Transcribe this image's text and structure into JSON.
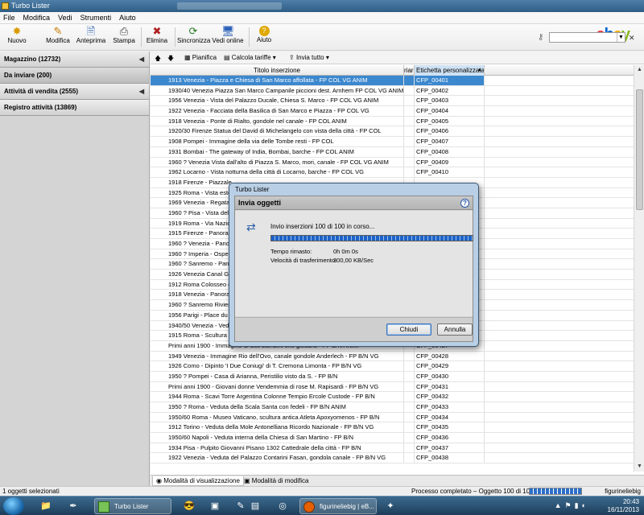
{
  "window": {
    "title": "Turbo Lister"
  },
  "menu": [
    "File",
    "Modifica",
    "Vedi",
    "Strumenti",
    "Aiuto"
  ],
  "toolbar": {
    "buttons": [
      "Nuovo",
      "Modifica",
      "Anteprima",
      "Stampa",
      "Elimina",
      "Sincronizza",
      "Vedi online",
      "Aiuto"
    ]
  },
  "brand": {
    "e": "e",
    "b": "b",
    "a": "a",
    "y": "y"
  },
  "sidebar": {
    "items": [
      "Magazzino (12732)",
      "Da inviare (200)",
      "Attività di vendita (2555)",
      "Registro attività (13869)"
    ]
  },
  "content_toolbar": {
    "pianifica": "Pianifica",
    "calcola": "Calcola tariffe",
    "invia": "Invia tutto"
  },
  "table": {
    "headers": {
      "title": "Titolo inserzione",
      "r": "riar",
      "label": "Etichetta personalizzata"
    },
    "sort_indicator": "▲",
    "rows": [
      {
        "title": "1913 Venezia - Piazza e Chiesa di San Marco affollata - FP COL VG ANIM",
        "label": "CFP_00401"
      },
      {
        "title": "1930/40 Venezia Piazza San Marco Campanile piccioni dest. Arnhem FP COL VG ANIM",
        "label": "CFP_00402"
      },
      {
        "title": "1956 Venezia - Vista del Palazzo Ducale, Chiesa S. Marco - FP COL VG ANIM",
        "label": "CFP_00403"
      },
      {
        "title": "1922 Venezia - Facciata della Basilica di San Marco e Piazza - FP COL VG",
        "label": "CFP_00404"
      },
      {
        "title": "1918 Venezia - Ponte di Rialto, gondole nel canale - FP COL ANIM",
        "label": "CFP_00405"
      },
      {
        "title": "1920/30 Firenze Statua del David di Michelangelo con vista della città - FP COL",
        "label": "CFP_00406"
      },
      {
        "title": "1908 Pompei - Immagine della via delle Tombe resti - FP COL",
        "label": "CFP_00407"
      },
      {
        "title": "1931 Bombai - The gateway of India, Bombai, barche - FP COL ANIM",
        "label": "CFP_00408"
      },
      {
        "title": "1960 ? Venezia Vista dall'alto di Piazza S. Marco, mori, canale - FP COL VG ANIM",
        "label": "CFP_00409"
      },
      {
        "title": "1962 Locarno - Vista notturna della città di Locarno, barche - FP COL VG",
        "label": "CFP_00410"
      },
      {
        "title": "1918 Firenze - Piazzale",
        "label": ""
      },
      {
        "title": "1925 Roma - Vista este",
        "label": ""
      },
      {
        "title": "1969 Venezia - Regata",
        "label": ""
      },
      {
        "title": "1960 ? Pisa - Vista del D",
        "label": ""
      },
      {
        "title": "1919 Roma - Via Nazio",
        "label": ""
      },
      {
        "title": "1915 Firenze - Panoran",
        "label": ""
      },
      {
        "title": "1960 ? Venezia - Panor",
        "label": ""
      },
      {
        "title": "1960 ? Imperia - Osped",
        "label": ""
      },
      {
        "title": "1960 ? Sanremo - Panor",
        "label": ""
      },
      {
        "title": "1926 Venezia Canal Gra",
        "label": ""
      },
      {
        "title": "1912 Roma Colosseo di",
        "label": ""
      },
      {
        "title": "1918 Venezia - Panoran",
        "label": ""
      },
      {
        "title": "1960 ? Sanremo Riviera",
        "label": ""
      },
      {
        "title": "1956 Parigi - Place du C",
        "label": ""
      },
      {
        "title": "1940/50 Venezia - Veduta",
        "label": ""
      },
      {
        "title": "1915 Roma - Scultura",
        "label": ""
      },
      {
        "title": "Primi anni 1900 - Immagine di due bambini che giocano - FP B/N ANIM",
        "label": "CFP_00427"
      },
      {
        "title": "1949 Venezia - Immagine Rio dell'Ovo, canale gondole Anderlech - FP B/N VG",
        "label": "CFP_00428"
      },
      {
        "title": "1926 Como - Dipinto 'I Due Coniugi' di T. Cremona Limonta - FP B/N VG",
        "label": "CFP_00429"
      },
      {
        "title": "1950 ? Pompei - Casa di Arianna, Peristilio visto da S. - FP B/N",
        "label": "CFP_00430"
      },
      {
        "title": "Primi anni 1900 - Giovani donne Vendemmia di rose M. Rapisardi - FP B/N VG",
        "label": "CFP_00431"
      },
      {
        "title": "1944 Roma - Scavi Torre Argentina Colonne Tempio Ercole Custode - FP B/N",
        "label": "CFP_00432"
      },
      {
        "title": "1950 ? Roma - Veduta della Scala Santa con fedeli - FP B/N ANIM",
        "label": "CFP_00433"
      },
      {
        "title": "1950/60 Roma - Museo Vaticano, scultura antica Atleta Apoxyomenos - FP B/N",
        "label": "CFP_00434"
      },
      {
        "title": "1912 Torino - Veduta della Mole Antonelliana Ricordo Nazionale - FP B/N VG",
        "label": "CFP_00435"
      },
      {
        "title": "1950/60 Napoli - Veduta interna della Chiesa di San Martino - FP B/N",
        "label": "CFP_00436"
      },
      {
        "title": "1934 Pisa - Pulpito Giovanni Pisano 1302 Cattedrale della città - FP B/N",
        "label": "CFP_00437"
      },
      {
        "title": "1922 Venezia - Veduta del Palazzo Contarini Fasan, gondola canale - FP B/N VG",
        "label": "CFP_00438"
      }
    ]
  },
  "bottom_tabs": [
    "Modalità di visualizzazione",
    "Modalità di modifica"
  ],
  "status": {
    "left": "1 oggetti selezionati",
    "middle": "Processo completato – Oggetto 100 di 100",
    "right": "figurineliebig",
    "progress": 1.0
  },
  "dialog": {
    "window_title": "Turbo Lister",
    "header": "Invia oggetti",
    "message": "Invio inserzioni 100 di 100 in corso...",
    "progress": 1.0,
    "fields": [
      {
        "label": "Tempo rimasto:",
        "value": "0h 0m 0s"
      },
      {
        "label": "Velocità di trasferimento:",
        "value": "300,00 KB/Sec"
      }
    ],
    "buttons": {
      "close": "Chiudi",
      "cancel": "Annulla"
    }
  },
  "taskbar": {
    "active_app": "Turbo Lister",
    "firefox_window": "figurineliebig | eB...",
    "time": "20:43",
    "date": "16/11/2013"
  }
}
